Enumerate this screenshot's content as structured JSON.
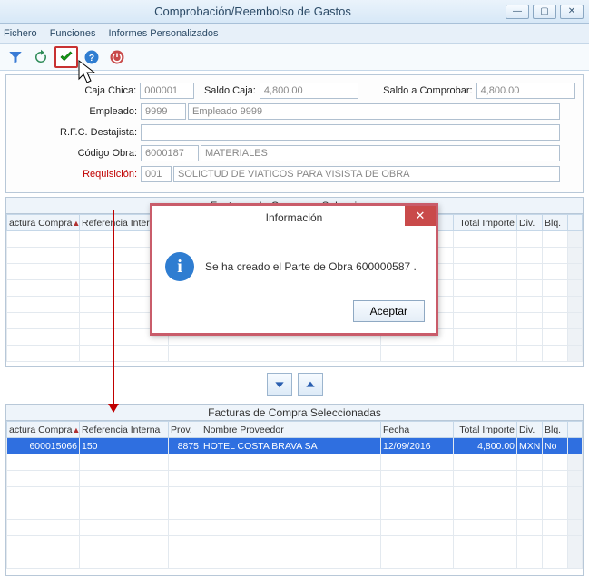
{
  "window": {
    "title": "Comprobación/Reembolso de Gastos",
    "min_tip": "Minimizar",
    "max_tip": "Maximizar",
    "close_tip": "Cerrar"
  },
  "menu": {
    "fichero": "Fichero",
    "funciones": "Funciones",
    "informes": "Informes Personalizados"
  },
  "toolbar": {
    "filter": "Filtrar",
    "refresh": "Refrescar",
    "accept": "Aceptar",
    "help": "Ayuda",
    "exit": "Salir"
  },
  "form": {
    "caja_chica_lbl": "Caja Chica:",
    "caja_chica_val": "000001",
    "saldo_caja_lbl": "Saldo Caja:",
    "saldo_caja_val": "4,800.00",
    "saldo_comprobar_lbl": "Saldo a Comprobar:",
    "saldo_comprobar_val": "4,800.00",
    "empleado_lbl": "Empleado:",
    "empleado_val": "9999",
    "empleado_desc": "Empleado 9999",
    "rfc_lbl": "R.F.C. Destajista:",
    "rfc_val": "",
    "codigo_obra_lbl": "Código Obra:",
    "codigo_obra_val": "6000187",
    "codigo_obra_desc": "MATERIALES",
    "req_lbl": "Requisición:",
    "req_val": "001",
    "req_desc": "SOLICTUD DE VIATICOS PARA VISISTA DE OBRA"
  },
  "sections": {
    "top": "Facturas de Compra a Seleccionar",
    "bottom": "Facturas de Compra Seleccionadas"
  },
  "table": {
    "cols": {
      "fc": "actura Compra",
      "ri": "Referencia Interna",
      "prov": "Prov.",
      "np": "Nombre Proveedor",
      "fecha": "Fecha",
      "ti": "Total Importe",
      "div": "Div.",
      "blq": "Blq."
    },
    "selected_row": {
      "fc": "600015066",
      "ri": "150",
      "prov": "8875",
      "np": "HOTEL COSTA BRAVA SA",
      "fecha": "12/09/2016",
      "ti": "4,800.00",
      "div": "MXN",
      "blq": "No"
    }
  },
  "modal": {
    "title": "Información",
    "message": "Se ha creado el Parte de Obra  600000587 .",
    "accept": "Aceptar"
  },
  "colors": {
    "accent_red": "#c00000",
    "link_blue": "#2f6fe0"
  }
}
